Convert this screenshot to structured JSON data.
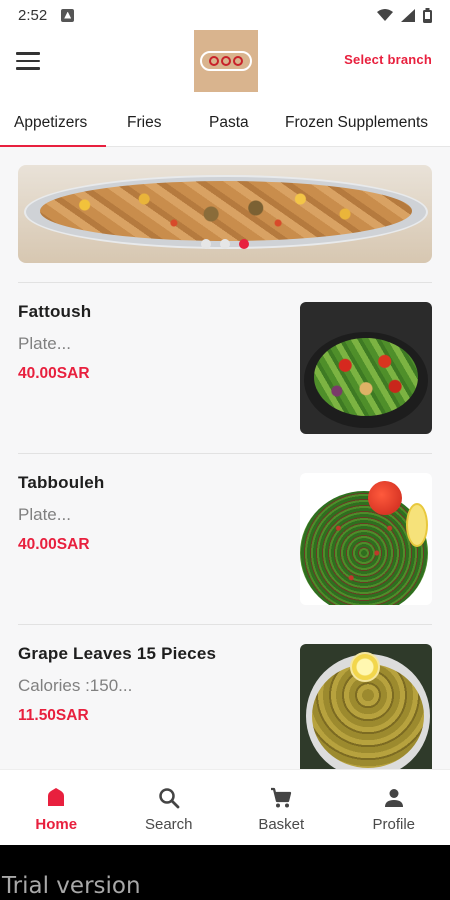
{
  "status_bar": {
    "time": "2:52",
    "icons": [
      "notification-icon",
      "wifi-icon",
      "signal-icon",
      "battery-icon"
    ]
  },
  "app_bar": {
    "menu_icon": "hamburger-menu-icon",
    "logo_icon": "restaurant-logo",
    "select_branch": "Select branch"
  },
  "tabs": [
    {
      "label": "Appetizers",
      "active": true
    },
    {
      "label": "Fries",
      "active": false
    },
    {
      "label": "Pasta",
      "active": false
    },
    {
      "label": "Frozen Supplements",
      "active": false
    }
  ],
  "banner": {
    "slide_count": 3,
    "active_slide": 3
  },
  "menu_items": [
    {
      "name": "Fattoush",
      "description": "Plate...",
      "price": "40.00SAR"
    },
    {
      "name": "Tabbouleh",
      "description": "Plate...",
      "price": "40.00SAR"
    },
    {
      "name": "Grape Leaves 15 Pieces",
      "description": "Calories :150...",
      "price": "11.50SAR"
    }
  ],
  "bottom_nav": [
    {
      "label": "Home",
      "icon": "home-icon",
      "active": true
    },
    {
      "label": "Search",
      "icon": "search-icon",
      "active": false
    },
    {
      "label": "Basket",
      "icon": "cart-icon",
      "active": false
    },
    {
      "label": "Profile",
      "icon": "person-icon",
      "active": false
    }
  ],
  "watermark": "Trial version",
  "colors": {
    "accent": "#e8203e",
    "text": "#1e1e1e",
    "muted": "#808080",
    "background": "#f7f7f8"
  }
}
